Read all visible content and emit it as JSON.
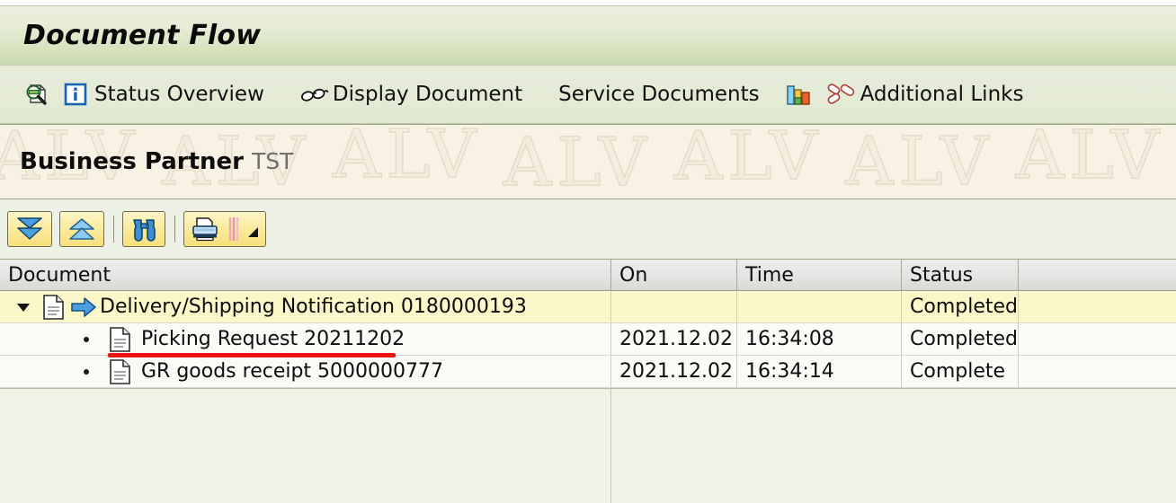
{
  "window": {
    "title": "Document Flow"
  },
  "app_toolbar": {
    "items": [
      {
        "icon": "document-search-icon",
        "label": ""
      },
      {
        "icon": "info-icon",
        "label": "Status Overview"
      },
      {
        "icon": "glasses-icon",
        "label": "Display Document"
      },
      {
        "icon": "",
        "label": "Service Documents"
      },
      {
        "icon": "bar-chart-icon",
        "label": ""
      },
      {
        "icon": "links-icon",
        "label": "Additional Links"
      }
    ],
    "status_overview_label": "Status Overview",
    "display_document_label": "Display Document",
    "service_documents_label": "Service Documents",
    "additional_links_label": "Additional Links"
  },
  "context_band": {
    "title": "Business Partner",
    "subtitle": "TST",
    "watermark": "ALV"
  },
  "alv_toolbar": {
    "buttons": [
      {
        "name": "expand-all-button",
        "icon": "double-down-arrow-icon"
      },
      {
        "name": "collapse-all-button",
        "icon": "double-up-arrow-icon"
      },
      {
        "name": "find-button",
        "icon": "binoculars-icon"
      },
      {
        "name": "print-preview-button",
        "icon": "printer-icon"
      }
    ]
  },
  "table": {
    "columns": [
      "Document",
      "On",
      "Time",
      "Status",
      ""
    ],
    "rows": [
      {
        "document": "Delivery/Shipping Notification 0180000193",
        "on": "",
        "time": "",
        "status": "Completed",
        "level": 0,
        "expanded": true,
        "selected": true,
        "annotated": false
      },
      {
        "document": "Picking Request 20211202",
        "on": "2021.12.02",
        "time": "16:34:08",
        "status": "Completed",
        "level": 1,
        "expanded": false,
        "selected": false,
        "annotated": true
      },
      {
        "document": "GR goods receipt 5000000777",
        "on": "2021.12.02",
        "time": "16:34:14",
        "status": "Complete",
        "level": 1,
        "expanded": false,
        "selected": false,
        "annotated": false
      }
    ]
  },
  "colors": {
    "title_bar_top": "#eaf0dc",
    "title_bar_bottom": "#c9d9ab",
    "toolbar_bg": "#e2e9d2",
    "watermark_bg": "#f7f2e4",
    "selected_row": "#fbf7c8",
    "annotation_red": "#f21212",
    "button_yellow": "#fbeb9d",
    "accent_blue": "#2f7fd0"
  }
}
